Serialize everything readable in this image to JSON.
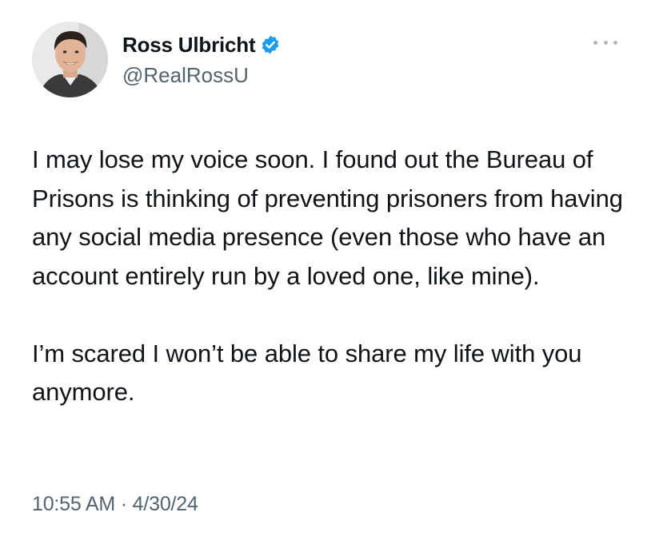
{
  "author": {
    "display_name": "Ross Ulbricht",
    "handle": "@RealRossU",
    "verified_color": "#1d9bf0",
    "avatar_icon": "profile-photo"
  },
  "tweet": {
    "paragraphs": [
      "I may lose my voice soon. I found out the Bureau of Prisons is thinking of preventing prisoners from having any social media presence (even those who have an account entirely run by a loved one, like mine).",
      "I’m scared I won’t be able to share my life with you anymore."
    ],
    "time": "10:55 AM",
    "separator": "·",
    "date": "4/30/24"
  },
  "icons": {
    "more": "more-options-icon",
    "verified": "verified-badge-icon"
  },
  "colors": {
    "text": "#0f1419",
    "secondary": "#536471",
    "accent": "#1d9bf0"
  }
}
